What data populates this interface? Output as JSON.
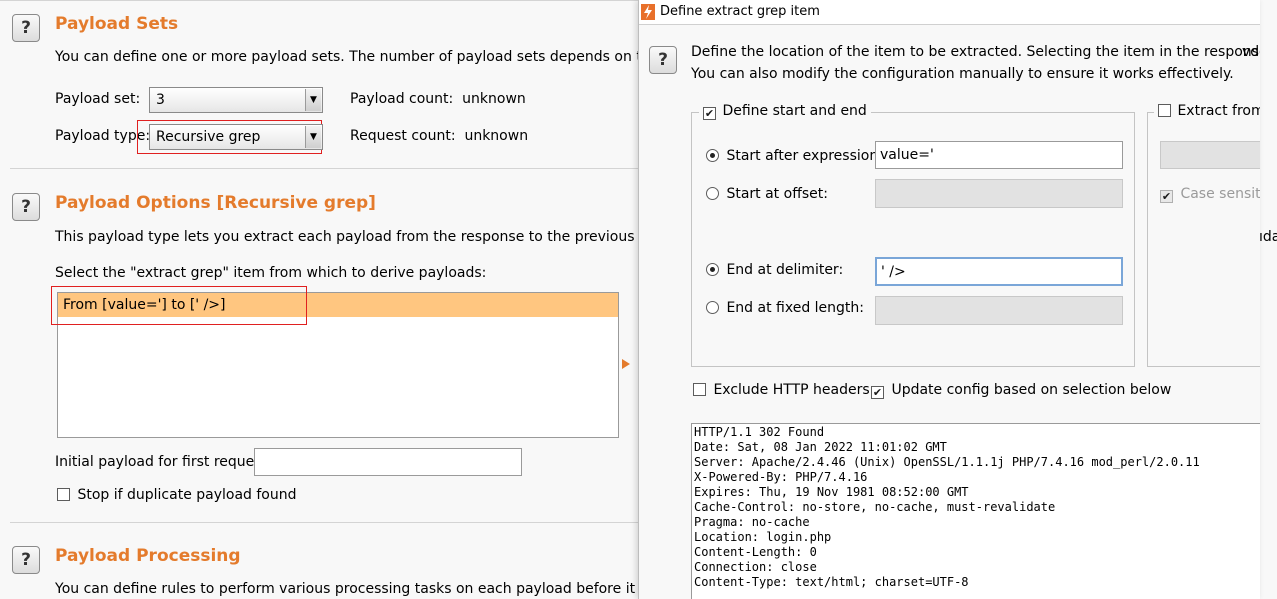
{
  "payload_sets": {
    "title": "Payload Sets",
    "description": "You can define one or more payload sets. The number of payload sets depends on the atta",
    "set_label": "Payload set:",
    "set_value": "3",
    "count_label": "Payload count:",
    "count_value": "unknown",
    "type_label": "Payload type:",
    "type_value": "Recursive grep",
    "request_label": "Request count:",
    "request_value": "unknown"
  },
  "payload_options": {
    "title": "Payload Options [Recursive grep]",
    "description": "This payload type lets you extract each payload from the response to the previous request",
    "select_label": "Select the \"extract grep\" item from which to derive payloads:",
    "items": [
      "From [value='] to [' />]"
    ],
    "initial_label": "Initial payload for first request:",
    "initial_value": "",
    "stop_label": "Stop if duplicate payload found",
    "cut_right_text": "ıdata"
  },
  "payload_processing": {
    "title": "Payload Processing",
    "description": "You can define rules to perform various processing tasks on each payload before it is used"
  },
  "dialog": {
    "title": "Define extract grep item",
    "desc_line1": "Define the location of the item to be extracted. Selecting the item in the response panel",
    "desc_line1_cut": "vd e",
    "desc_line2": "You can also modify the configuration manually to ensure it works effectively.",
    "define_start_end": "Define start and end",
    "start_after_label": "Start after expression:",
    "start_after_value": "value='",
    "start_offset_label": "Start at offset:",
    "end_delim_label": "End at delimiter:",
    "end_delim_value": "' />",
    "end_fixed_label": "End at fixed length:",
    "extract_from": "Extract from",
    "case_sensitive": "Case sensit",
    "exclude_http": "Exclude HTTP headers",
    "update_config": "Update config based on selection below",
    "response_lines": [
      "HTTP/1.1 302 Found",
      "Date: Sat, 08 Jan 2022 11:01:02 GMT",
      "Server: Apache/2.4.46 (Unix) OpenSSL/1.1.1j PHP/7.4.16 mod_perl/2.0.11",
      "X-Powered-By: PHP/7.4.16",
      "Expires: Thu, 19 Nov 1981 08:52:00 GMT",
      "Cache-Control: no-store, no-cache, must-revalidate",
      "Pragma: no-cache",
      "Location: login.php",
      "Content-Length: 0",
      "Connection: close",
      "Content-Type: text/html; charset=UTF-8"
    ]
  },
  "help_glyph": "?",
  "icons": {
    "help": "question-icon",
    "dropdown": "chevron-down-icon",
    "app": "burp-logo-icon",
    "arrow": "triangle-right-icon"
  },
  "colors": {
    "accent": "#e47b2c",
    "selection": "#ffc680",
    "highlight_box": "#e02020"
  }
}
